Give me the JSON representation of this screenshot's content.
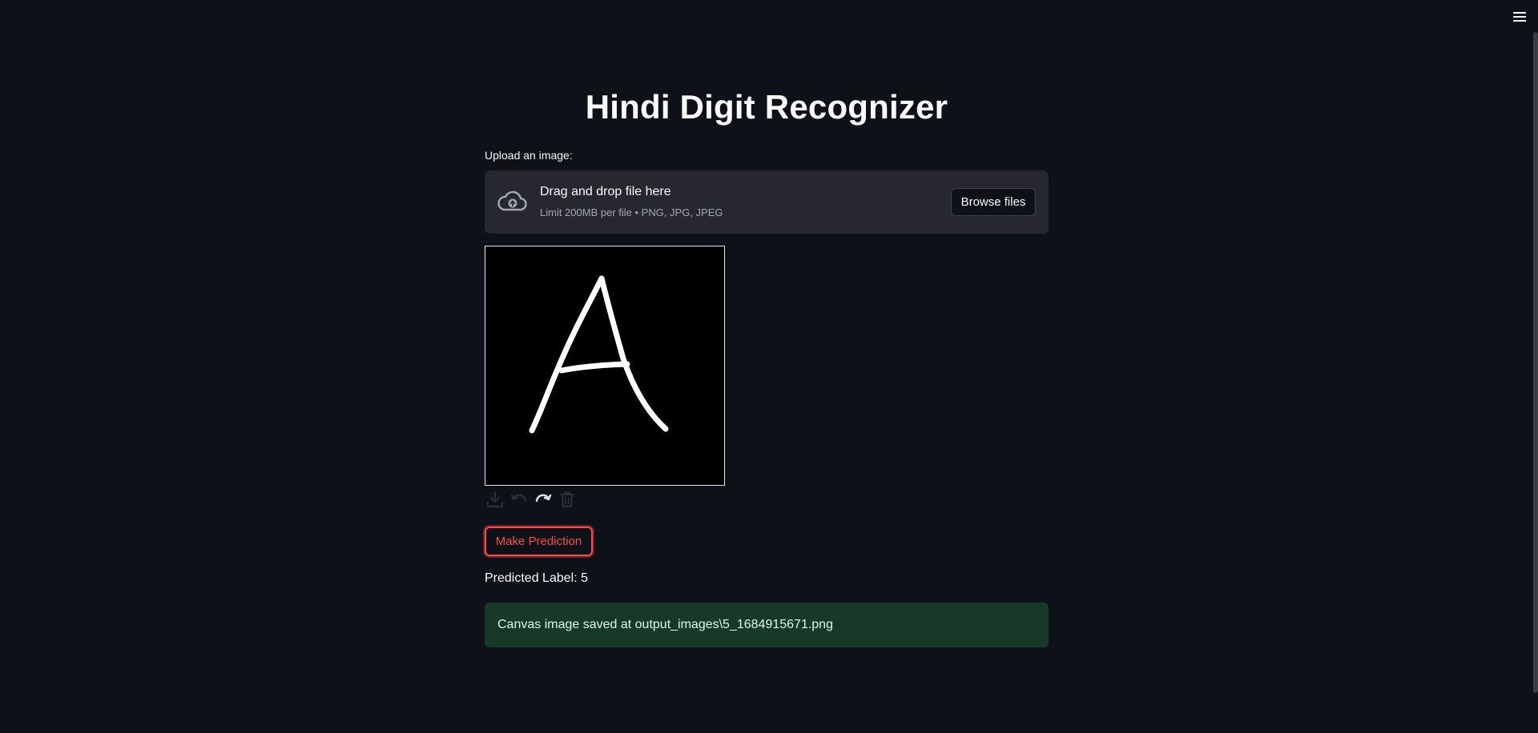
{
  "app": {
    "title": "Hindi Digit Recognizer"
  },
  "uploader": {
    "label": "Upload an image:",
    "drop_text": "Drag and drop file here",
    "limit_text": "Limit 200MB per file • PNG, JPG, JPEG",
    "browse_label": "Browse files",
    "icon": "cloud-upload-icon"
  },
  "canvas": {
    "background": "#000000",
    "stroke_color": "#ffffff",
    "toolbar": [
      "download-icon",
      "undo-icon",
      "redo-icon",
      "trash-icon"
    ]
  },
  "actions": {
    "predict_label": "Make Prediction"
  },
  "result": {
    "predicted_text": "Predicted Label: 5",
    "saved_message": "Canvas image saved at output_images\\5_1684915671.png"
  },
  "colors": {
    "background": "#0e1117",
    "accent": "#ff4b4b",
    "success_bg": "#173928",
    "dropzone_bg": "#262730"
  }
}
